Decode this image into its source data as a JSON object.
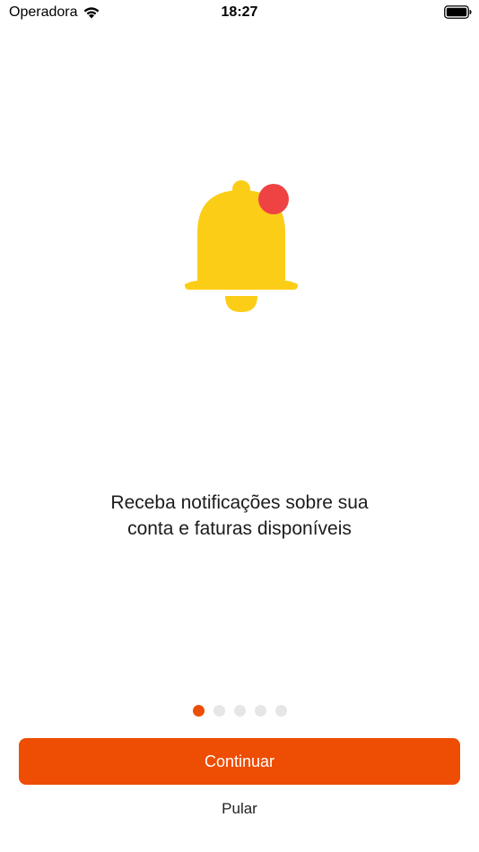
{
  "status_bar": {
    "carrier": "Operadora",
    "time": "18:27",
    "icons": [
      "wifi-icon",
      "battery-icon"
    ]
  },
  "illustration": {
    "icon": "bell-icon",
    "badge_icon": "notification-badge-icon",
    "bell_color": "#fccd16",
    "badge_color": "#ef4343"
  },
  "onboarding": {
    "message_line1": "Receba notificações sobre sua",
    "message_line2": "conta e faturas disponíveis",
    "page_count": 5,
    "current_page": 1
  },
  "actions": {
    "continue_label": "Continuar",
    "skip_label": "Pular"
  },
  "colors": {
    "accent": "#ee4d04",
    "dot_active": "#ea5005",
    "dot_inactive": "#e6e6e6"
  }
}
